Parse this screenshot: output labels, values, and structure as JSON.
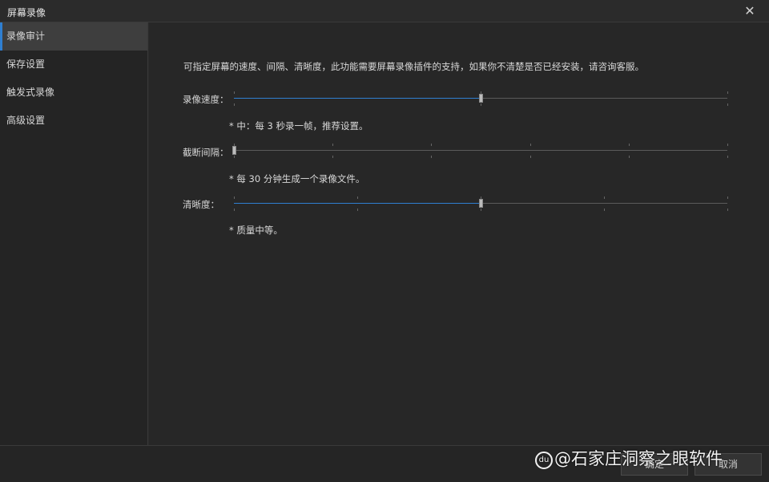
{
  "window": {
    "title": "屏幕录像",
    "close_glyph": "✕"
  },
  "sidebar": {
    "items": [
      {
        "label": "录像审计",
        "active": true
      },
      {
        "label": "保存设置",
        "active": false
      },
      {
        "label": "触发式录像",
        "active": false
      },
      {
        "label": "高级设置",
        "active": false
      }
    ]
  },
  "main": {
    "description": "可指定屏幕的速度、间隔、清晰度，此功能需要屏幕录像插件的支持，如果你不清楚是否已经安装，请咨询客服。",
    "speed": {
      "label": "录像速度：",
      "hint": "* 中：每 3 秒录一帧，推荐设置。",
      "level": 0.5,
      "tick_count": 3
    },
    "interval": {
      "label": "截断间隔：",
      "hint": "* 每 30 分钟生成一个录像文件。",
      "level": 0.0,
      "tick_count": 6
    },
    "clarity": {
      "label": "清晰度：",
      "hint": "* 质量中等。",
      "level": 0.5,
      "tick_count": 5
    }
  },
  "footer": {
    "ok_label": "确定",
    "cancel_label": "取消"
  },
  "watermark": {
    "logo_text": "du",
    "text": "@石家庄洞察之眼软件"
  },
  "colors": {
    "accent": "#2f7fd1",
    "background": "#272727",
    "sidebar_active": "#3e3e3e"
  }
}
